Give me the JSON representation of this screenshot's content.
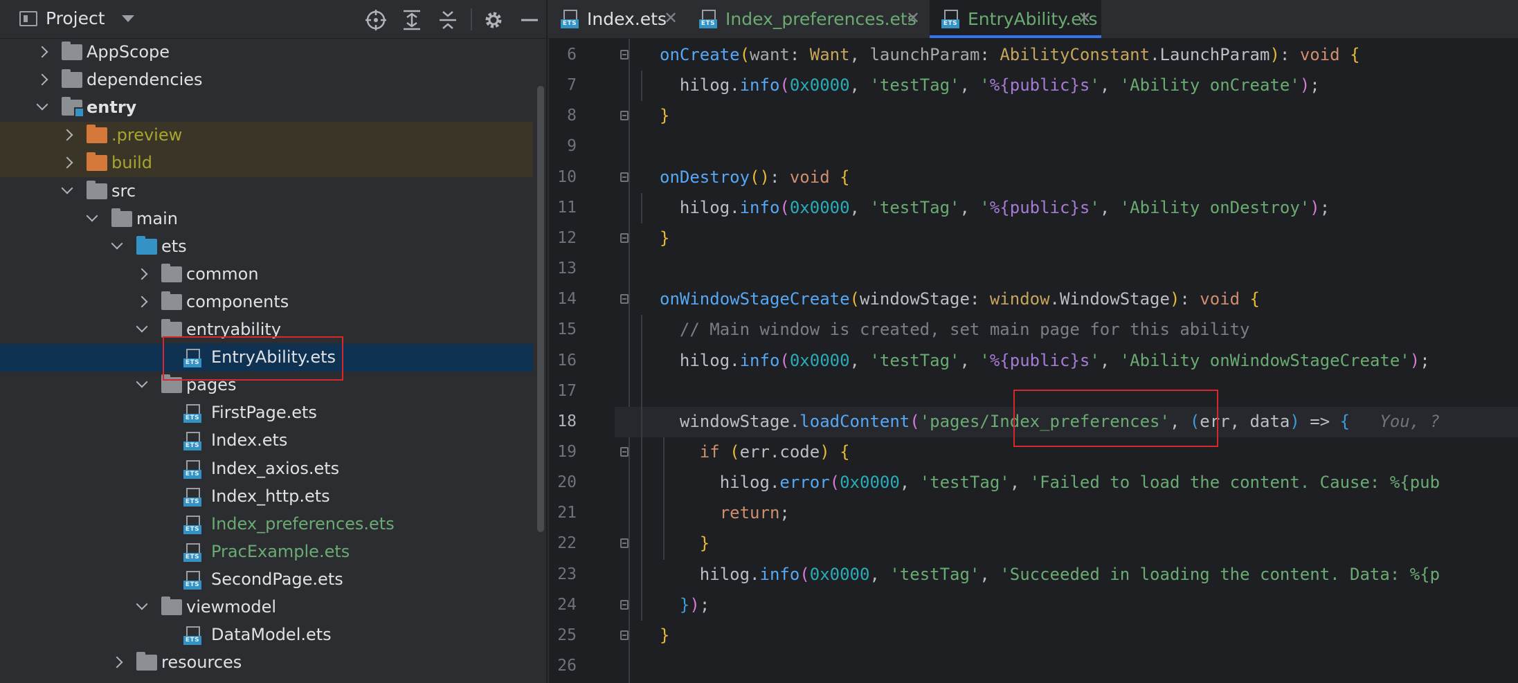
{
  "project": {
    "title": "Project",
    "header_icons": [
      "locate-icon",
      "expand-all-icon",
      "collapse-all-icon",
      "gear-icon",
      "minimize-icon"
    ]
  },
  "tree": [
    {
      "label": "AppScope",
      "icon": "folder",
      "expand": "collapsed",
      "style": "normal"
    },
    {
      "label": "dependencies",
      "icon": "folder",
      "expand": "collapsed",
      "style": "normal"
    },
    {
      "label": "entry",
      "icon": "module-folder",
      "expand": "expanded",
      "style": "bold"
    },
    {
      "label": ".preview",
      "icon": "folder-excluded",
      "expand": "collapsed",
      "style": "olive"
    },
    {
      "label": "build",
      "icon": "folder-excluded",
      "expand": "collapsed",
      "style": "olive"
    },
    {
      "label": "src",
      "icon": "folder",
      "expand": "expanded",
      "style": "normal"
    },
    {
      "label": "main",
      "icon": "folder",
      "expand": "expanded",
      "style": "normal"
    },
    {
      "label": "ets",
      "icon": "source-folder",
      "expand": "expanded",
      "style": "normal"
    },
    {
      "label": "common",
      "icon": "folder",
      "expand": "collapsed",
      "style": "normal"
    },
    {
      "label": "components",
      "icon": "folder",
      "expand": "collapsed",
      "style": "normal"
    },
    {
      "label": "entryability",
      "icon": "folder",
      "expand": "expanded",
      "style": "normal"
    },
    {
      "label": "EntryAbility.ets",
      "icon": "ets-file",
      "expand": "none",
      "style": "selected"
    },
    {
      "label": "pages",
      "icon": "folder",
      "expand": "expanded",
      "style": "normal"
    },
    {
      "label": "FirstPage.ets",
      "icon": "ets-file",
      "expand": "none",
      "style": "normal"
    },
    {
      "label": "Index.ets",
      "icon": "ets-file",
      "expand": "none",
      "style": "normal"
    },
    {
      "label": "Index_axios.ets",
      "icon": "ets-file",
      "expand": "none",
      "style": "normal"
    },
    {
      "label": "Index_http.ets",
      "icon": "ets-file",
      "expand": "none",
      "style": "normal"
    },
    {
      "label": "Index_preferences.ets",
      "icon": "ets-file",
      "expand": "none",
      "style": "green"
    },
    {
      "label": "PracExample.ets",
      "icon": "ets-file",
      "expand": "none",
      "style": "green"
    },
    {
      "label": "SecondPage.ets",
      "icon": "ets-file",
      "expand": "none",
      "style": "normal"
    },
    {
      "label": "viewmodel",
      "icon": "folder",
      "expand": "expanded",
      "style": "normal"
    },
    {
      "label": "DataModel.ets",
      "icon": "ets-file",
      "expand": "none",
      "style": "normal"
    },
    {
      "label": "resources",
      "icon": "folder",
      "expand": "collapsed",
      "style": "normal"
    }
  ],
  "tabs": [
    {
      "label": "Index.ets",
      "close": "✕",
      "active": false,
      "color": "#dfe1e5"
    },
    {
      "label": "Index_preferences.ets",
      "close": "✕",
      "active": false,
      "color": "#6aab73"
    },
    {
      "label": "EntryAbility.ets",
      "close": "✕",
      "active": true,
      "color": "#6aab73"
    }
  ],
  "editor": {
    "current_line": "18",
    "lines": [
      {
        "no": "6",
        "t": [
          [
            "fn",
            "onCreate"
          ],
          [
            "b1",
            "("
          ],
          [
            "par",
            "want"
          ],
          [
            "id",
            ": "
          ],
          [
            "ty",
            "Want"
          ],
          [
            "id",
            ", "
          ],
          [
            "par",
            "launchParam"
          ],
          [
            "id",
            ": "
          ],
          [
            "ty",
            "AbilityConstant"
          ],
          [
            "id",
            ".LaunchParam"
          ],
          [
            "b1",
            ")"
          ],
          [
            "id",
            ": "
          ],
          [
            "k",
            "void "
          ],
          [
            "b1",
            "{"
          ]
        ]
      },
      {
        "no": "7",
        "t": [
          [
            "id",
            "  hilog."
          ],
          [
            "fn",
            "info"
          ],
          [
            "b2",
            "("
          ],
          [
            "n",
            "0x0000"
          ],
          [
            "id",
            ", "
          ],
          [
            "s",
            "'testTag'"
          ],
          [
            "id",
            ", "
          ],
          [
            "s",
            "'"
          ],
          [
            "fmt",
            "%{public}s"
          ],
          [
            "s",
            "'"
          ],
          [
            "id",
            ", "
          ],
          [
            "s",
            "'Ability onCreate'"
          ],
          [
            "b2",
            ")"
          ],
          [
            "id",
            ";"
          ]
        ]
      },
      {
        "no": "8",
        "t": [
          [
            "b1",
            "}"
          ]
        ]
      },
      {
        "no": "9",
        "t": []
      },
      {
        "no": "10",
        "t": [
          [
            "fn",
            "onDestroy"
          ],
          [
            "b1",
            "()"
          ],
          [
            "id",
            ": "
          ],
          [
            "k",
            "void "
          ],
          [
            "b1",
            "{"
          ]
        ]
      },
      {
        "no": "11",
        "t": [
          [
            "id",
            "  hilog."
          ],
          [
            "fn",
            "info"
          ],
          [
            "b2",
            "("
          ],
          [
            "n",
            "0x0000"
          ],
          [
            "id",
            ", "
          ],
          [
            "s",
            "'testTag'"
          ],
          [
            "id",
            ", "
          ],
          [
            "s",
            "'"
          ],
          [
            "fmt",
            "%{public}s"
          ],
          [
            "s",
            "'"
          ],
          [
            "id",
            ", "
          ],
          [
            "s",
            "'Ability onDestroy'"
          ],
          [
            "b2",
            ")"
          ],
          [
            "id",
            ";"
          ]
        ]
      },
      {
        "no": "12",
        "t": [
          [
            "b1",
            "}"
          ]
        ]
      },
      {
        "no": "13",
        "t": []
      },
      {
        "no": "14",
        "t": [
          [
            "fn",
            "onWindowStageCreate"
          ],
          [
            "b1",
            "("
          ],
          [
            "id",
            "windowStage: "
          ],
          [
            "ty",
            "window"
          ],
          [
            "id",
            ".WindowStage"
          ],
          [
            "b1",
            ")"
          ],
          [
            "id",
            ": "
          ],
          [
            "k",
            "void "
          ],
          [
            "b1",
            "{"
          ]
        ]
      },
      {
        "no": "15",
        "t": [
          [
            "c",
            "  // Main window is created, set main page for this ability"
          ]
        ]
      },
      {
        "no": "16",
        "t": [
          [
            "id",
            "  hilog."
          ],
          [
            "fn",
            "info"
          ],
          [
            "b2",
            "("
          ],
          [
            "n",
            "0x0000"
          ],
          [
            "id",
            ", "
          ],
          [
            "s",
            "'testTag'"
          ],
          [
            "id",
            ", "
          ],
          [
            "s",
            "'"
          ],
          [
            "fmt",
            "%{public}s"
          ],
          [
            "s",
            "'"
          ],
          [
            "id",
            ", "
          ],
          [
            "s",
            "'Ability onWindowStageCreate'"
          ],
          [
            "b2",
            ")"
          ],
          [
            "id",
            ";"
          ]
        ]
      },
      {
        "no": "17",
        "t": []
      },
      {
        "no": "18",
        "t": [
          [
            "id",
            "  windowStage."
          ],
          [
            "fn",
            "loadContent"
          ],
          [
            "b2",
            "("
          ],
          [
            "s",
            "'pages/Index_preferences'"
          ],
          [
            "id",
            ", "
          ],
          [
            "b3",
            "("
          ],
          [
            "id",
            "err, data"
          ],
          [
            "b3",
            ")"
          ],
          [
            "id",
            " => "
          ],
          [
            "b3",
            "{"
          ],
          [
            "hint",
            "   You, ?"
          ]
        ]
      },
      {
        "no": "19",
        "t": [
          [
            "k",
            "    if "
          ],
          [
            "b1",
            "("
          ],
          [
            "id",
            "err.code"
          ],
          [
            "b1",
            ")"
          ],
          [
            "id",
            " "
          ],
          [
            "b1",
            "{"
          ]
        ]
      },
      {
        "no": "20",
        "t": [
          [
            "id",
            "      hilog."
          ],
          [
            "fn",
            "error"
          ],
          [
            "b2",
            "("
          ],
          [
            "n",
            "0x0000"
          ],
          [
            "id",
            ", "
          ],
          [
            "s",
            "'testTag'"
          ],
          [
            "id",
            ", "
          ],
          [
            "s",
            "'Failed to load the content. Cause: %{pub"
          ]
        ]
      },
      {
        "no": "21",
        "t": [
          [
            "k",
            "      return"
          ],
          [
            "id",
            ";"
          ]
        ]
      },
      {
        "no": "22",
        "t": [
          [
            "b1",
            "    }"
          ]
        ]
      },
      {
        "no": "23",
        "t": [
          [
            "id",
            "    hilog."
          ],
          [
            "fn",
            "info"
          ],
          [
            "b2",
            "("
          ],
          [
            "n",
            "0x0000"
          ],
          [
            "id",
            ", "
          ],
          [
            "s",
            "'testTag'"
          ],
          [
            "id",
            ", "
          ],
          [
            "s",
            "'Succeeded in loading the content. Data: %{p"
          ]
        ]
      },
      {
        "no": "24",
        "t": [
          [
            "b3",
            "  }"
          ],
          [
            "b2",
            ")"
          ],
          [
            "id",
            ";"
          ]
        ]
      },
      {
        "no": "25",
        "t": [
          [
            "b1",
            "}"
          ]
        ]
      },
      {
        "no": "26",
        "t": []
      }
    ]
  }
}
